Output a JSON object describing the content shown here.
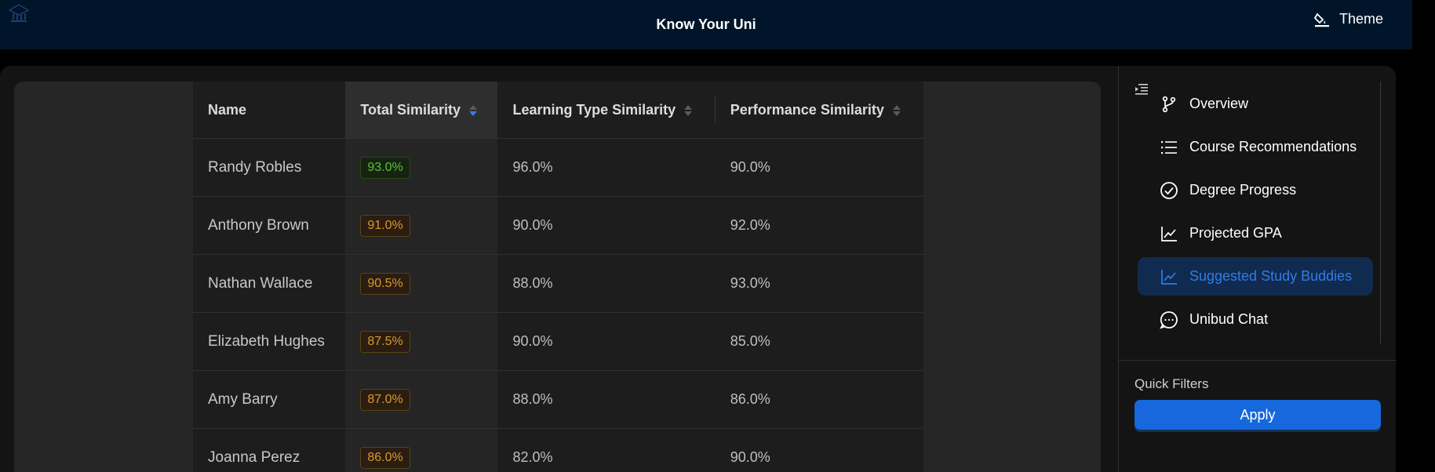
{
  "header": {
    "title": "Know Your Uni",
    "theme_label": "Theme",
    "logo_text": "Know Your Uni"
  },
  "table": {
    "columns": [
      "Name",
      "Total Similarity",
      "Learning Type Similarity",
      "Performance Similarity"
    ],
    "sorted_column": "Total Similarity",
    "rows": [
      {
        "name": "Randy Robles",
        "total": "93.0%",
        "learning": "96.0%",
        "performance": "90.0%",
        "tag_color": "green"
      },
      {
        "name": "Anthony Brown",
        "total": "91.0%",
        "learning": "90.0%",
        "performance": "92.0%",
        "tag_color": "gold"
      },
      {
        "name": "Nathan Wallace",
        "total": "90.5%",
        "learning": "88.0%",
        "performance": "93.0%",
        "tag_color": "gold"
      },
      {
        "name": "Elizabeth Hughes",
        "total": "87.5%",
        "learning": "90.0%",
        "performance": "85.0%",
        "tag_color": "gold"
      },
      {
        "name": "Amy Barry",
        "total": "87.0%",
        "learning": "88.0%",
        "performance": "86.0%",
        "tag_color": "gold"
      },
      {
        "name": "Joanna Perez",
        "total": "86.0%",
        "learning": "82.0%",
        "performance": "90.0%",
        "tag_color": "gold"
      }
    ]
  },
  "sidebar": {
    "items": [
      {
        "label": "Overview",
        "icon": "branch-icon",
        "active": false
      },
      {
        "label": "Course Recommendations",
        "icon": "list-icon",
        "active": false
      },
      {
        "label": "Degree Progress",
        "icon": "check-circle-icon",
        "active": false
      },
      {
        "label": "Projected GPA",
        "icon": "line-chart-icon",
        "active": false
      },
      {
        "label": "Suggested Study Buddies",
        "icon": "line-chart-icon",
        "active": true
      },
      {
        "label": "Unibud Chat",
        "icon": "message-icon",
        "active": false
      }
    ],
    "quick_filters_title": "Quick Filters",
    "apply_label": "Apply"
  },
  "colors": {
    "accent": "#1668dc",
    "header_bg": "#001529",
    "tag_green": "#5bc234",
    "tag_gold": "#d89a2a"
  }
}
